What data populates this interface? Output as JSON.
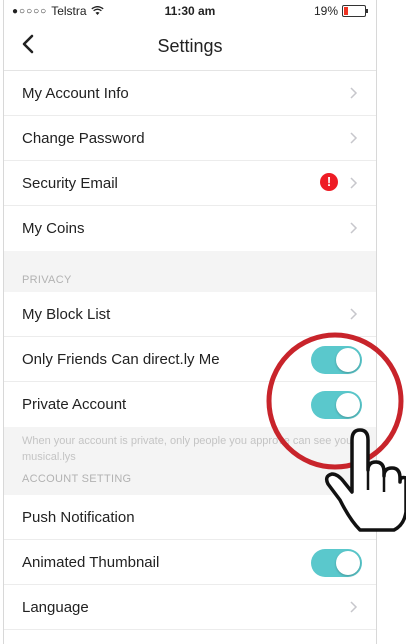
{
  "status_bar": {
    "carrier": "Telstra",
    "signal_dots": "●○○○○",
    "time": "11:30 am",
    "battery": "19%",
    "battery_level": 0.19
  },
  "nav": {
    "title": "Settings"
  },
  "account_rows": [
    {
      "label": "My Account Info"
    },
    {
      "label": "Change Password"
    },
    {
      "label": "Security Email",
      "alert": "!"
    },
    {
      "label": "My Coins"
    }
  ],
  "privacy": {
    "header": "PRIVACY",
    "rows": [
      {
        "label": "My Block List"
      },
      {
        "label": "Only Friends Can direct.ly Me",
        "toggle": true
      },
      {
        "label": "Private Account",
        "toggle": true
      }
    ],
    "footnote": "When your account is private, only people you approve can see your musical.lys"
  },
  "account_setting": {
    "header": "ACCOUNT SETTING",
    "rows": [
      {
        "label": "Push Notification"
      },
      {
        "label": "Animated Thumbnail",
        "toggle": true
      },
      {
        "label": "Language"
      }
    ]
  },
  "colors": {
    "toggle_on": "#5ac8cc",
    "alert": "#ee1c25",
    "highlight_circle": "#c8242b"
  },
  "icons": {
    "back": "chevron-left-icon",
    "row_chevron": "chevron-right-icon",
    "alert": "exclamation-circle-icon",
    "pointer": "hand-pointer-icon"
  }
}
